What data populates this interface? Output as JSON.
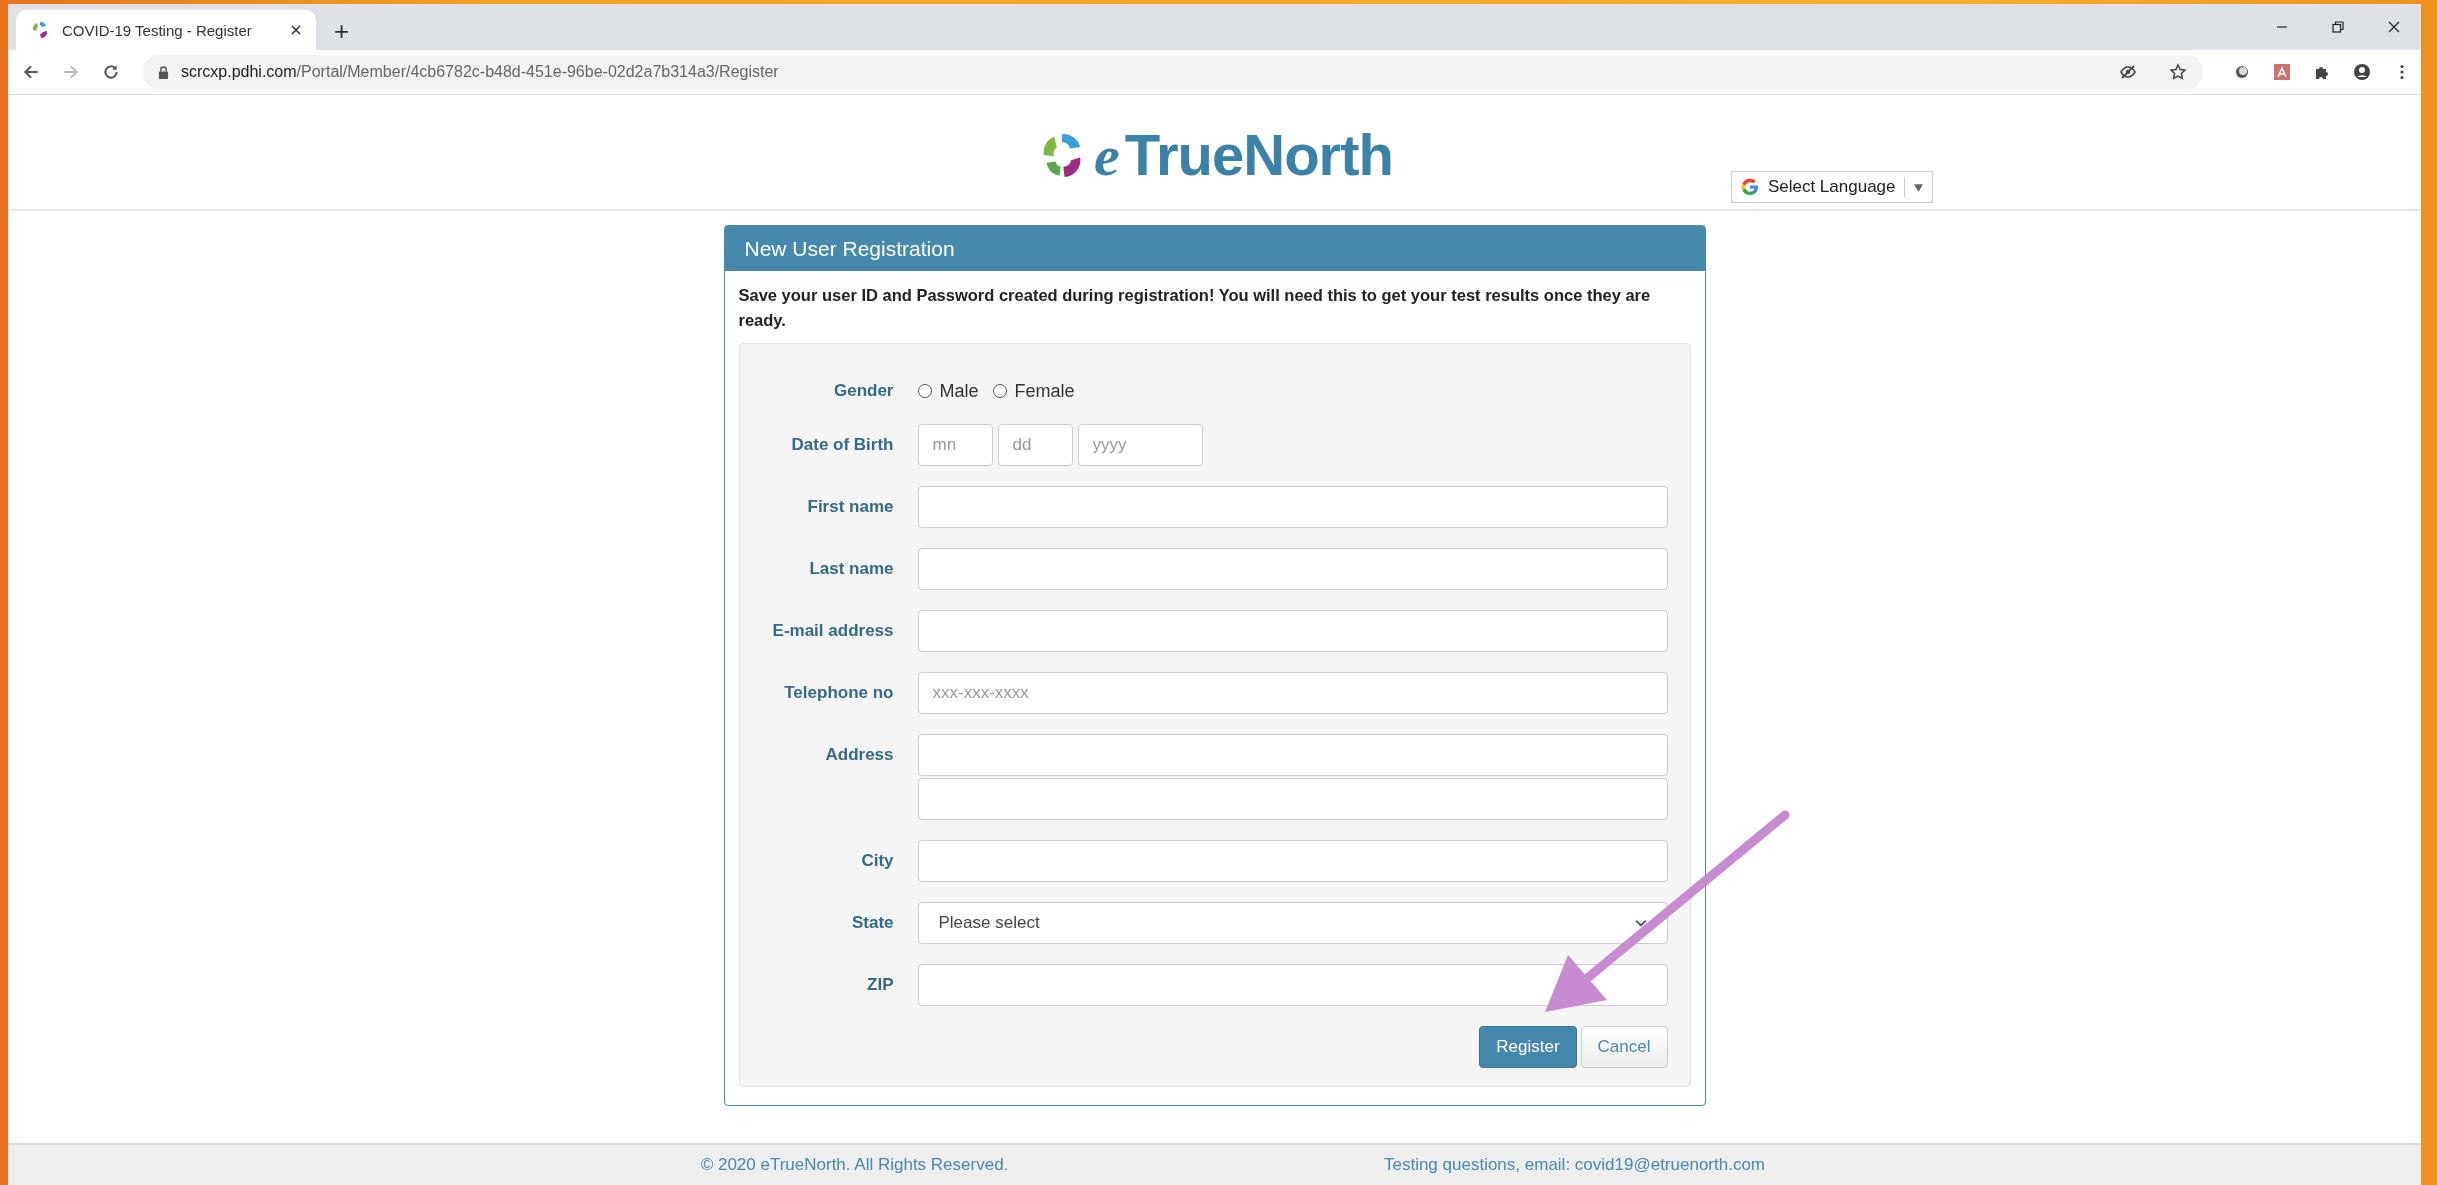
{
  "browser": {
    "tab": {
      "title": "COVID-19 Testing - Register",
      "selected": true
    },
    "url_host": "scrcxp.pdhi.com",
    "url_path": "/Portal/Member/4cb6782c-b48d-451e-96be-02d2a7b314a3/Register",
    "new_tab": "+"
  },
  "header": {
    "logo_prefix": "e",
    "logo_text": "TrueNorth",
    "language_select": "Select Language"
  },
  "panel": {
    "title": "New User Registration",
    "notice": "Save your user ID and Password created during registration! You will need this to get your test results once they are ready.",
    "fields": [
      {
        "kind": "radio",
        "label": "Gender",
        "options": [
          {
            "label": "Male",
            "selected": false
          },
          {
            "label": "Female",
            "selected": false
          }
        ]
      },
      {
        "kind": "date",
        "label": "Date of Birth",
        "parts": [
          {
            "placeholder": "mn"
          },
          {
            "placeholder": "dd"
          },
          {
            "placeholder": "yyyy"
          }
        ]
      },
      {
        "kind": "text",
        "label": "First name"
      },
      {
        "kind": "text",
        "label": "Last name"
      },
      {
        "kind": "text",
        "label": "E-mail address"
      },
      {
        "kind": "text",
        "label": "Telephone no",
        "placeholder": "xxx-xxx-xxxx"
      },
      {
        "kind": "multiline",
        "label": "Address"
      },
      {
        "kind": "text",
        "label": "City"
      },
      {
        "kind": "select",
        "label": "State",
        "value": "Please select"
      },
      {
        "kind": "text",
        "label": "ZIP"
      }
    ],
    "buttons": [
      {
        "label": "Register",
        "kind": "primary"
      },
      {
        "label": "Cancel",
        "kind": "default"
      }
    ]
  },
  "footer": {
    "copyright": "© 2020 eTrueNorth. All Rights Reserved.",
    "contact": "Testing questions, email: covid19@etruenorth.com"
  }
}
